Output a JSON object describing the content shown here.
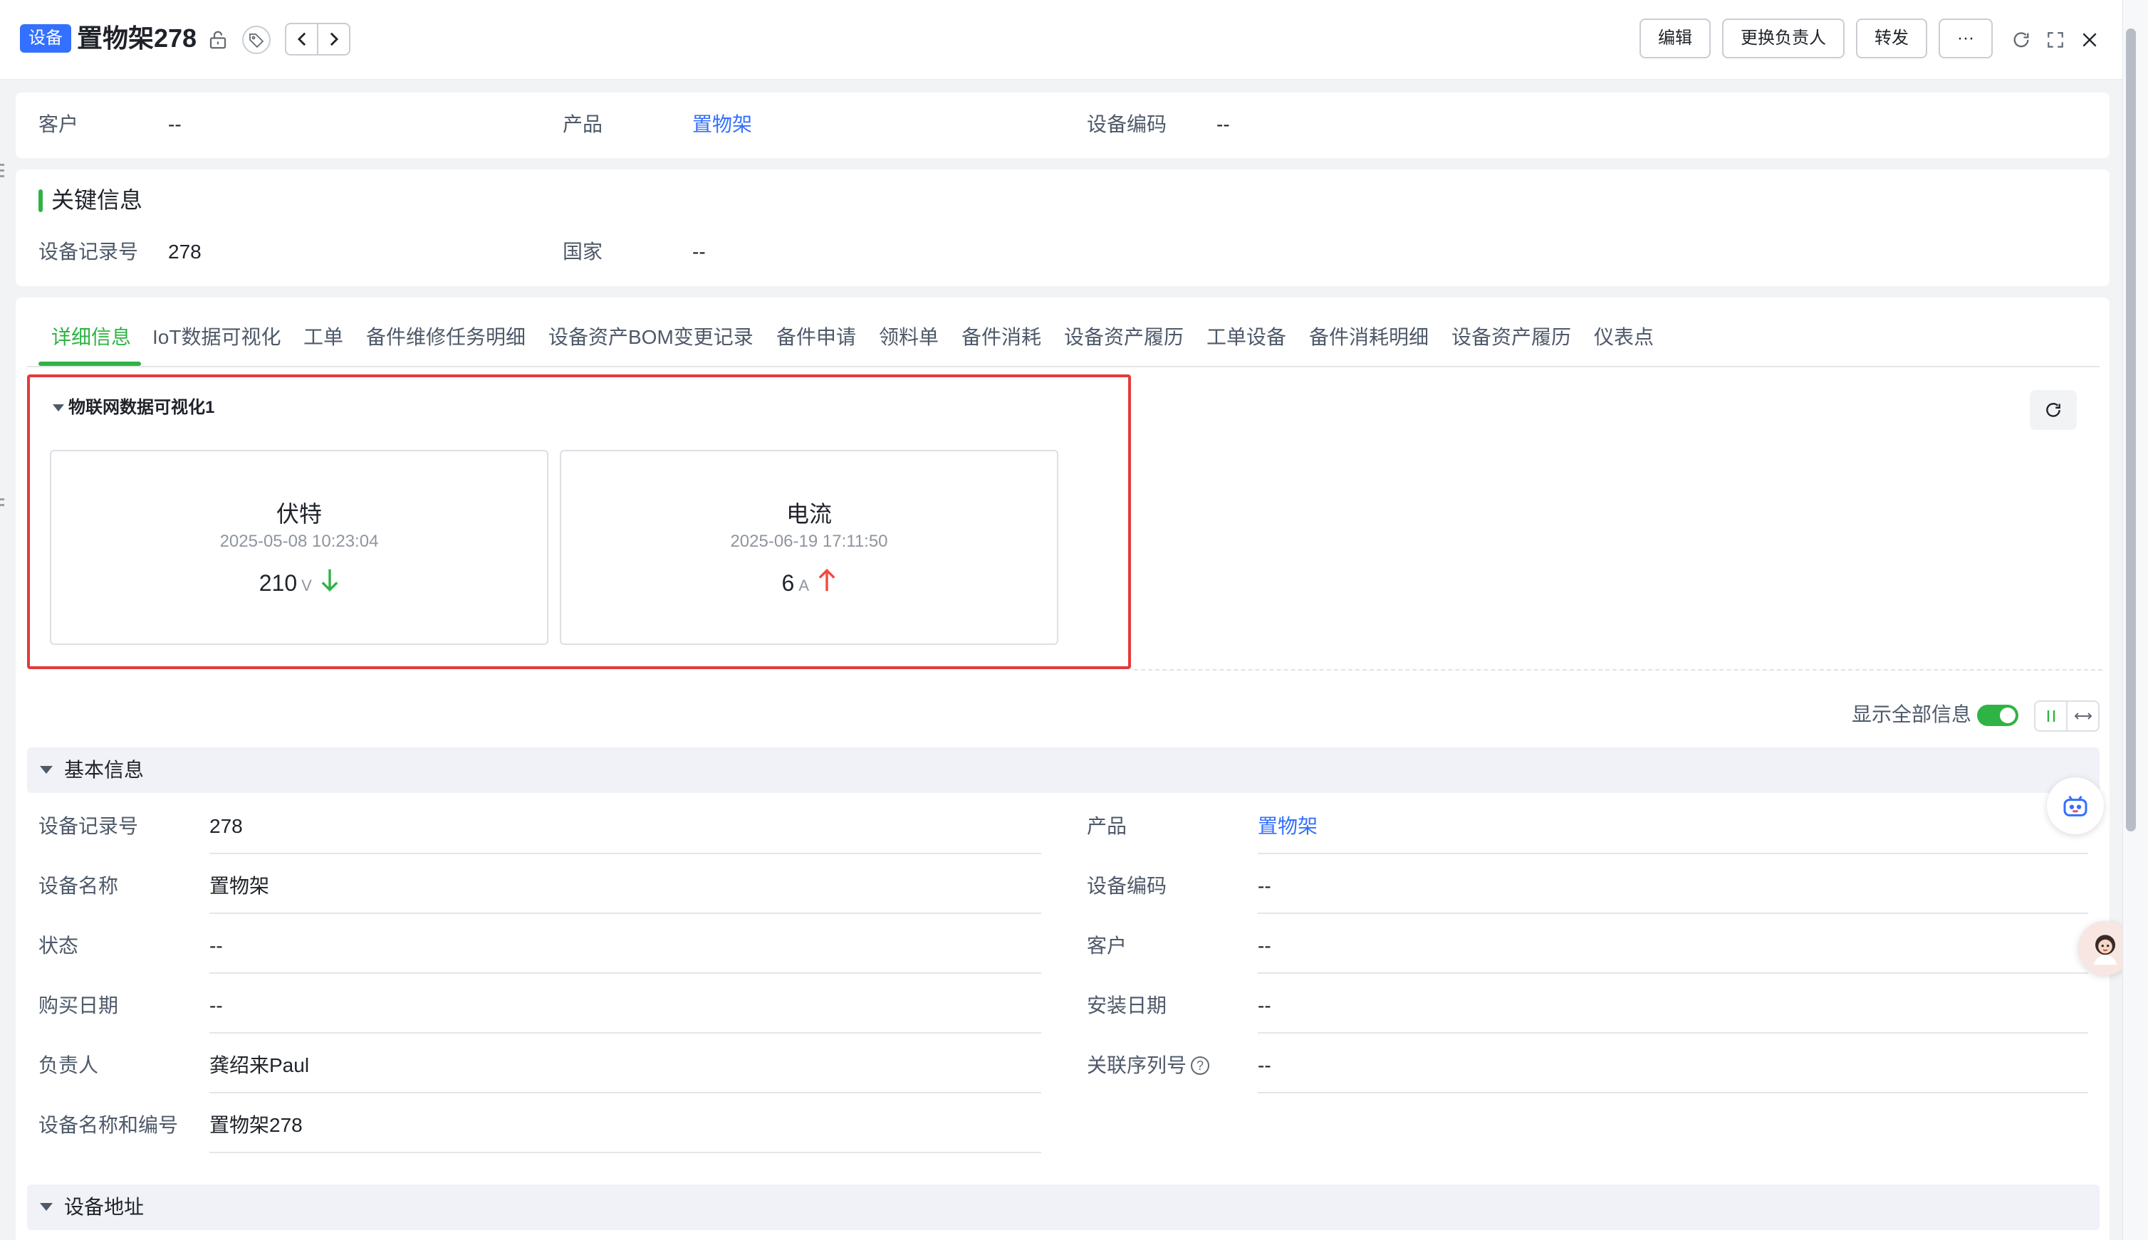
{
  "header": {
    "badge": "设备",
    "title": "置物架278",
    "buttons": {
      "edit": "编辑",
      "change_owner": "更换负责人",
      "forward": "转发",
      "more": "···"
    },
    "icons": [
      "lock-icon",
      "tag-icon",
      "chevron-left-icon",
      "chevron-right-icon",
      "refresh-icon",
      "fullscreen-icon",
      "close-icon"
    ]
  },
  "summary": {
    "customer_label": "客户",
    "customer_value": "--",
    "product_label": "产品",
    "product_value": "置物架",
    "code_label": "设备编码",
    "code_value": "--"
  },
  "key_info": {
    "title": "关键信息",
    "record_label": "设备记录号",
    "record_value": "278",
    "country_label": "国家",
    "country_value": "--"
  },
  "tabs": [
    "详细信息",
    "IoT数据可视化",
    "工单",
    "备件维修任务明细",
    "设备资产BOM变更记录",
    "备件申请",
    "领料单",
    "备件消耗",
    "设备资产履历",
    "工单设备",
    "备件消耗明细",
    "设备资产履历",
    "仪表点"
  ],
  "iot": {
    "title": "物联网数据可视化1",
    "cards": [
      {
        "name": "伏特",
        "time": "2025-05-08 10:23:04",
        "value": "210",
        "unit": "V",
        "trend": "down",
        "trend_color": "#2fb344"
      },
      {
        "name": "电流",
        "time": "2025-06-19 17:11:50",
        "value": "6",
        "unit": "A",
        "trend": "up",
        "trend_color": "#f5483b"
      }
    ]
  },
  "controls": {
    "show_all_label": "显示全部信息",
    "show_all_on": true
  },
  "basic": {
    "title": "基本信息",
    "left": [
      {
        "label": "设备记录号",
        "value": "278"
      },
      {
        "label": "设备名称",
        "value": "置物架"
      },
      {
        "label": "状态",
        "value": "--"
      },
      {
        "label": "购买日期",
        "value": "--"
      },
      {
        "label": "负责人",
        "value": "龚绍来Paul"
      },
      {
        "label": "设备名称和编号",
        "value": "置物架278"
      }
    ],
    "right": [
      {
        "label": "产品",
        "value": "置物架"
      },
      {
        "label": "设备编码",
        "value": "--"
      },
      {
        "label": "客户",
        "value": "--"
      },
      {
        "label": "安装日期",
        "value": "--"
      },
      {
        "label": "关联序列号",
        "value": "--"
      }
    ]
  },
  "address": {
    "title": "设备地址"
  },
  "colors": {
    "accent": "#2fb344",
    "link": "#3370ff",
    "badge": "#3370ff",
    "highlight_border": "#e33b3b"
  }
}
